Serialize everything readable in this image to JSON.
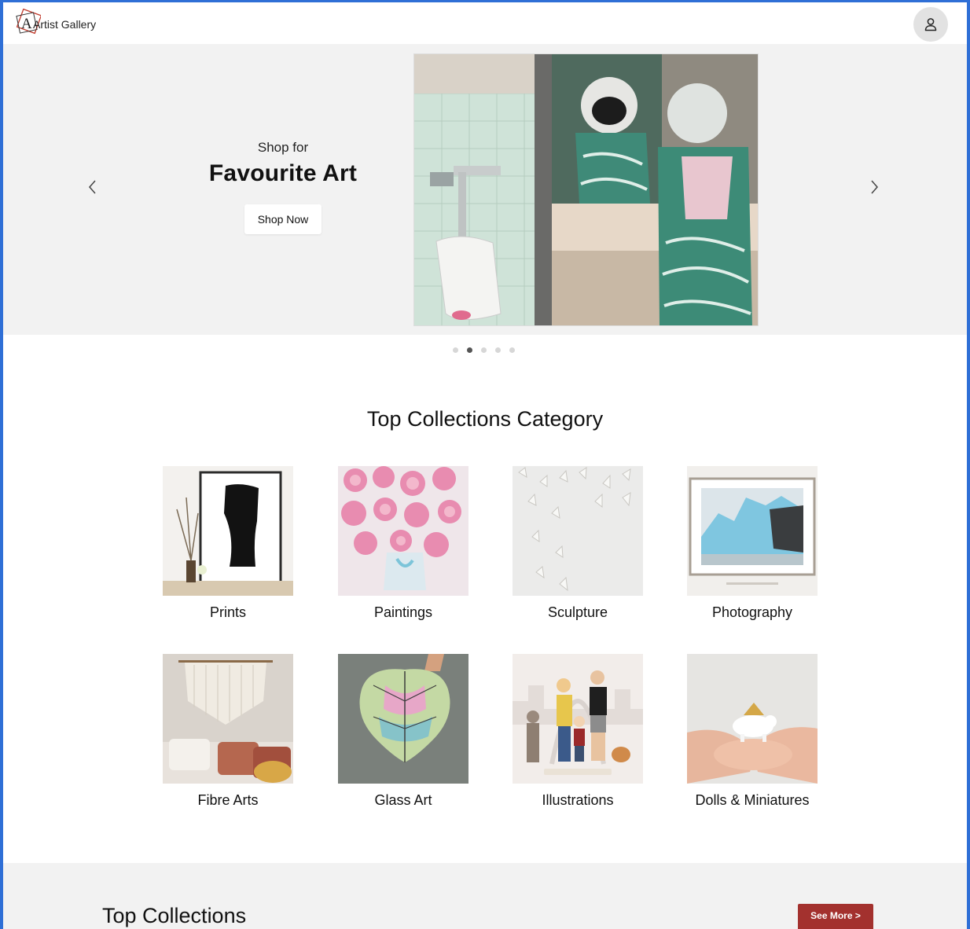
{
  "header": {
    "logo_text": "Artist Gallery",
    "logo_icon": "logo-icon",
    "profile_icon": "user-icon"
  },
  "hero": {
    "subtitle": "Shop for",
    "title": "Favourite Art",
    "button_label": "Shop Now",
    "prev_icon": "chevron-left-icon",
    "next_icon": "chevron-right-icon",
    "slides": 5,
    "active_slide": 2
  },
  "categories": {
    "title": "Top Collections Category",
    "items": [
      {
        "label": "Prints"
      },
      {
        "label": "Paintings"
      },
      {
        "label": "Sculpture"
      },
      {
        "label": "Photography"
      },
      {
        "label": "Fibre Arts"
      },
      {
        "label": "Glass Art"
      },
      {
        "label": "Illustrations"
      },
      {
        "label": "Dolls & Miniatures"
      }
    ]
  },
  "top_collections": {
    "title": "Top Collections",
    "button_label": "See More >"
  },
  "colors": {
    "accent": "#a3312e",
    "frame": "#2f6fd6",
    "hero_bg": "#f2f2f2"
  }
}
